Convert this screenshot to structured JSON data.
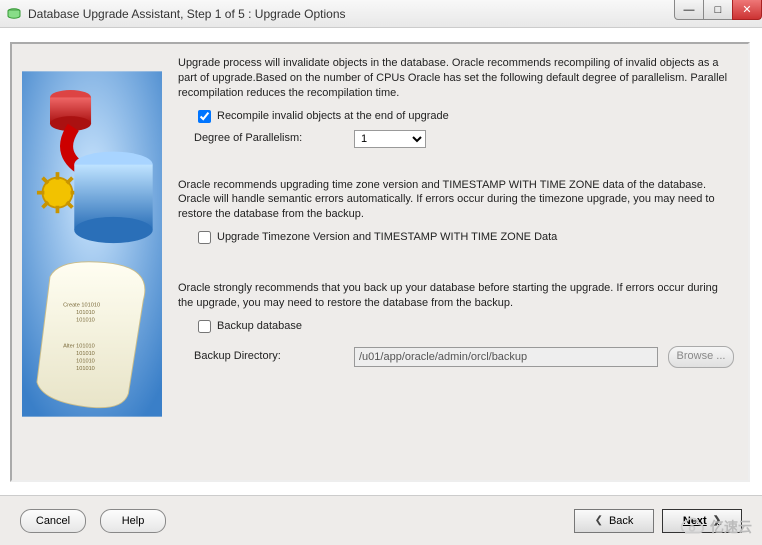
{
  "window": {
    "title": "Database Upgrade Assistant, Step 1 of 5 : Upgrade Options"
  },
  "sections": {
    "recompile": {
      "description": "Upgrade process will invalidate objects in the database. Oracle recommends recompiling of invalid objects as a part of upgrade.Based on the number of CPUs Oracle has set the following default degree of parallelism. Parallel recompilation reduces the recompilation time.",
      "checkbox_label": "Recompile invalid objects at the end of upgrade",
      "checkbox_checked": true,
      "dop_label": "Degree of Parallelism:",
      "dop_value": "1",
      "dop_options": [
        "1"
      ]
    },
    "timezone": {
      "description": "Oracle recommends upgrading time zone version and TIMESTAMP WITH TIME ZONE data of the database. Oracle will handle semantic errors automatically. If errors occur during the timezone upgrade, you may need to restore the database from the backup.",
      "checkbox_label": "Upgrade Timezone Version and TIMESTAMP WITH TIME ZONE Data",
      "checkbox_checked": false
    },
    "backup": {
      "description": "Oracle strongly recommends that you back up your database before starting the upgrade. If errors occur during the upgrade, you may need to restore the database from the backup.",
      "checkbox_label": "Backup database",
      "checkbox_checked": false,
      "dir_label": "Backup Directory:",
      "dir_value": "/u01/app/oracle/admin/orcl/backup",
      "browse_label": "Browse ..."
    }
  },
  "footer": {
    "cancel": "Cancel",
    "help": "Help",
    "back": "Back",
    "next": "Next"
  },
  "watermark": "亿速云"
}
